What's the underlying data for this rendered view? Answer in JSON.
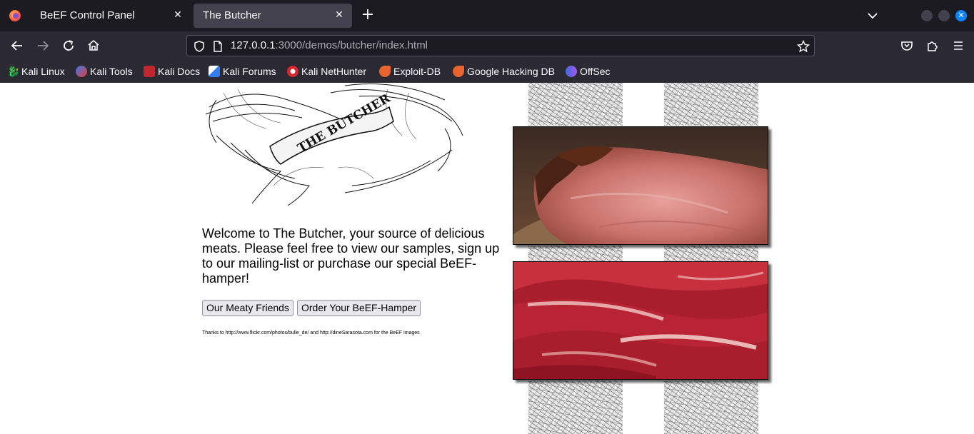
{
  "browser": {
    "tabs": [
      {
        "label": "BeEF Control Panel",
        "active": false
      },
      {
        "label": "The Butcher",
        "active": true
      }
    ],
    "url": {
      "host": "127.0.0.1",
      "path": ":3000/demos/butcher/index.html"
    },
    "bookmarks": [
      {
        "label": "Kali Linux",
        "icon": "kali-dragon-icon"
      },
      {
        "label": "Kali Tools",
        "icon": "kali-tools-icon"
      },
      {
        "label": "Kali Docs",
        "icon": "kali-docs-icon"
      },
      {
        "label": "Kali Forums",
        "icon": "kali-forums-icon"
      },
      {
        "label": "Kali NetHunter",
        "icon": "kali-nethunter-icon"
      },
      {
        "label": "Exploit-DB",
        "icon": "exploit-db-icon"
      },
      {
        "label": "Google Hacking DB",
        "icon": "exploit-db-icon"
      },
      {
        "label": "OffSec",
        "icon": "offsec-icon"
      }
    ],
    "accent": "#0a84ff"
  },
  "page": {
    "logo_text": "THE BUTCHER",
    "welcome": "Welcome to The Butcher, your source of delicious meats. Please feel free to view our samples, sign up to our mailing-list or purchase our special BeEF-hamper!",
    "buttons": {
      "friends": "Our Meaty Friends",
      "hamper": "Order Your BeEF-Hamper"
    },
    "credits": "Thanks to http://www.flickr.com/photos/bulle_de/ and http://dineSarasota.com for the BeEF images"
  }
}
